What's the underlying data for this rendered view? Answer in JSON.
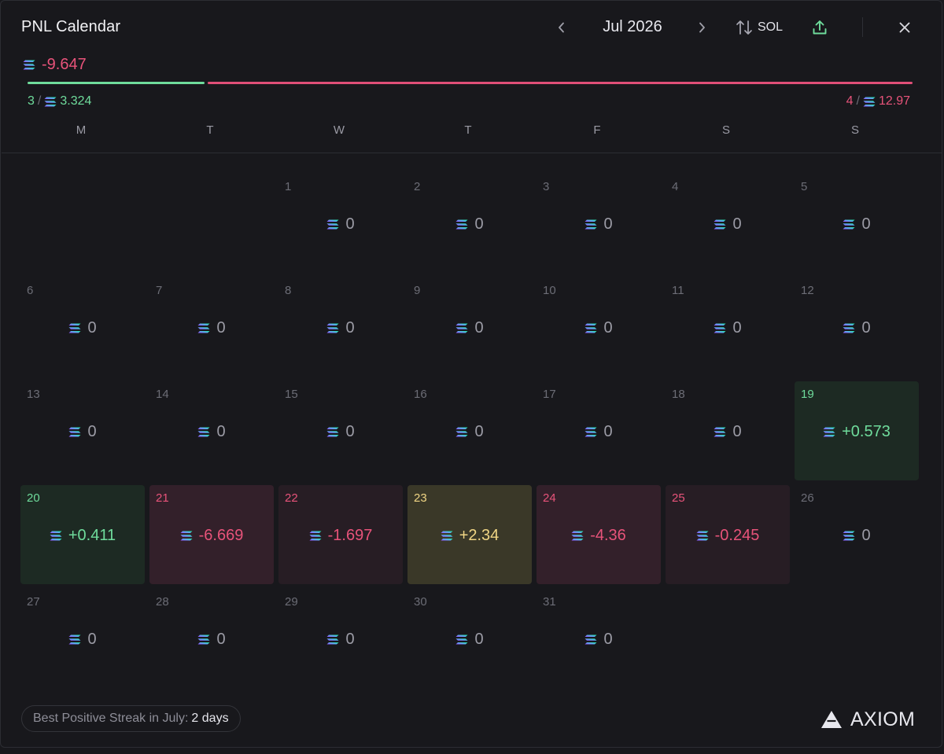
{
  "header": {
    "title": "PNL Calendar",
    "month": "Jul 2026",
    "currency": "SOL"
  },
  "summary": {
    "total": "-9.647",
    "positive_days": "3",
    "positive_total": "3.324",
    "negative_days": "4",
    "negative_total": "12.97",
    "positive_ratio": 0.2
  },
  "weekdays": [
    "M",
    "T",
    "W",
    "T",
    "F",
    "S",
    "S"
  ],
  "days": [
    {
      "day": "1",
      "value": "0",
      "state": "zero"
    },
    {
      "day": "2",
      "value": "0",
      "state": "zero"
    },
    {
      "day": "3",
      "value": "0",
      "state": "zero"
    },
    {
      "day": "4",
      "value": "0",
      "state": "zero"
    },
    {
      "day": "5",
      "value": "0",
      "state": "zero"
    },
    {
      "day": "6",
      "value": "0",
      "state": "zero"
    },
    {
      "day": "7",
      "value": "0",
      "state": "zero"
    },
    {
      "day": "8",
      "value": "0",
      "state": "zero"
    },
    {
      "day": "9",
      "value": "0",
      "state": "zero"
    },
    {
      "day": "10",
      "value": "0",
      "state": "zero"
    },
    {
      "day": "11",
      "value": "0",
      "state": "zero"
    },
    {
      "day": "12",
      "value": "0",
      "state": "zero"
    },
    {
      "day": "13",
      "value": "0",
      "state": "zero"
    },
    {
      "day": "14",
      "value": "0",
      "state": "zero"
    },
    {
      "day": "15",
      "value": "0",
      "state": "zero"
    },
    {
      "day": "16",
      "value": "0",
      "state": "zero"
    },
    {
      "day": "17",
      "value": "0",
      "state": "zero"
    },
    {
      "day": "18",
      "value": "0",
      "state": "zero"
    },
    {
      "day": "19",
      "value": "+0.573",
      "state": "pos"
    },
    {
      "day": "20",
      "value": "+0.411",
      "state": "pos"
    },
    {
      "day": "21",
      "value": "-6.669",
      "state": "neg"
    },
    {
      "day": "22",
      "value": "-1.697",
      "state": "neg-light"
    },
    {
      "day": "23",
      "value": "+2.34",
      "state": "yel"
    },
    {
      "day": "24",
      "value": "-4.36",
      "state": "neg"
    },
    {
      "day": "25",
      "value": "-0.245",
      "state": "neg-light"
    },
    {
      "day": "26",
      "value": "0",
      "state": "zero"
    },
    {
      "day": "27",
      "value": "0",
      "state": "zero"
    },
    {
      "day": "28",
      "value": "0",
      "state": "zero"
    },
    {
      "day": "29",
      "value": "0",
      "state": "zero"
    },
    {
      "day": "30",
      "value": "0",
      "state": "zero"
    },
    {
      "day": "31",
      "value": "0",
      "state": "zero"
    }
  ],
  "footer": {
    "streak_label": "Best Positive Streak in July:",
    "streak_value": "2 days",
    "brand": "AXIOM"
  },
  "icons": {
    "prev": "chevron-left-icon",
    "next": "chevron-right-icon",
    "swap": "swap-vertical-icon",
    "share": "upload-icon",
    "close": "close-icon",
    "token": "solana-icon",
    "logo": "axiom-logo-icon"
  },
  "colors": {
    "positive": "#6fdc9c",
    "negative": "#e8537a",
    "highlight": "#f0d584",
    "background": "#18181c"
  }
}
